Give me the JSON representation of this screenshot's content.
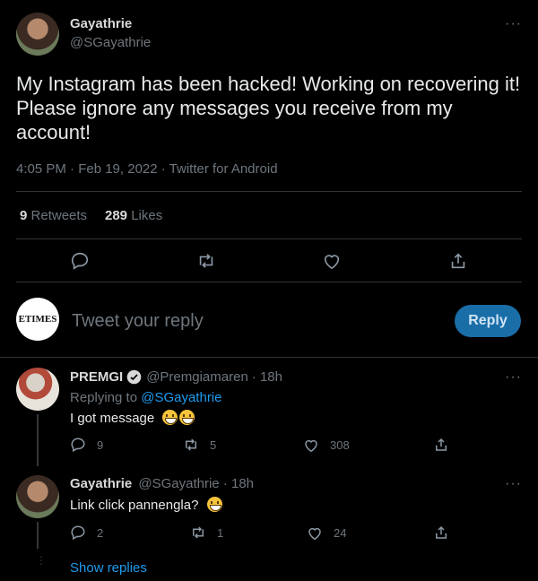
{
  "tweet": {
    "author_name": "Gayathrie",
    "author_handle": "@SGayathrie",
    "text": "My Instagram has been hacked! Working on recovering it! Please ignore any messages you receive from my account!",
    "meta": "4:05 PM · Feb 19, 2022 · Twitter for Android",
    "retweets_count": "9",
    "retweets_label": "Retweets",
    "likes_count": "289",
    "likes_label": "Likes"
  },
  "composer": {
    "avatar_text": "ETIMES",
    "placeholder": "Tweet your reply",
    "reply_label": "Reply"
  },
  "replies": [
    {
      "author_name": "PREMGI",
      "author_handle": "@Premgiamaren",
      "time": "· 18h",
      "replying_to_label": "Replying to",
      "replying_to_handle": "@SGayathrie",
      "text": "I got message",
      "reply_count": "9",
      "retweet_count": "5",
      "like_count": "308"
    },
    {
      "author_name": "Gayathrie",
      "author_handle": "@SGayathrie",
      "time": "· 18h",
      "text": "Link click pannengla?",
      "reply_count": "2",
      "retweet_count": "1",
      "like_count": "24"
    }
  ],
  "show_replies_label": "Show replies",
  "colors": {
    "background": "#000000",
    "accent": "#1d9bf0",
    "muted": "#6e767d",
    "divider": "#2f3336",
    "reply_button": "#1a6ea8"
  }
}
